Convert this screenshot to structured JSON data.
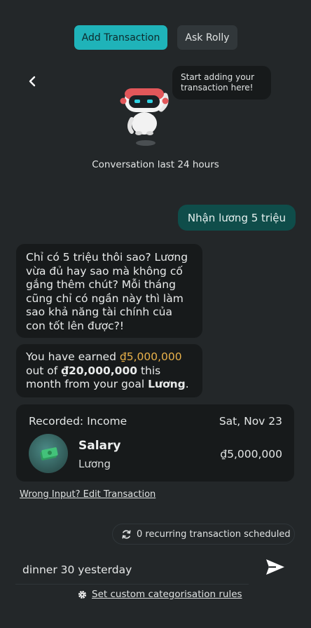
{
  "header": {
    "tabs": [
      {
        "label": "Add Transaction",
        "active": true
      },
      {
        "label": "Ask Rolly",
        "active": false
      }
    ]
  },
  "assistant": {
    "hint": "Start adding your transaction here!",
    "conversation_caption": "Conversation last 24 hours"
  },
  "messages": {
    "user": "Nhận lương 5 triệu",
    "bot_1": "Chỉ có 5 triệu thôi sao? Lương vừa đủ hay sao mà không cố gắng thêm chút? Mỗi tháng cũng chỉ có ngần này thì làm sao khả năng tài chính của con tốt lên được?!",
    "bot_2": {
      "prefix": "You have earned ",
      "earned": "₫5,000,000",
      "mid": " out of ",
      "target": "₫20,000,000",
      "mid2": " this month from your goal ",
      "goal": "Lương",
      "suffix": "."
    }
  },
  "record": {
    "kind": "Recorded: Income",
    "date": "Sat, Nov 23",
    "category": "Salary",
    "goal": "Lương",
    "amount": "₫5,000,000",
    "icon": "money-stack-icon"
  },
  "actions": {
    "edit_link": "Wrong Input? Edit Transaction",
    "recurring": "0 recurring transaction scheduled",
    "rules_link": "Set custom categorisation rules"
  },
  "input": {
    "value": "dinner 30 yesterday"
  },
  "colors": {
    "background": "#232729",
    "accent": "#1fb3b9",
    "user_bubble": "#0f4d4a",
    "highlight": "#e8b14a"
  }
}
